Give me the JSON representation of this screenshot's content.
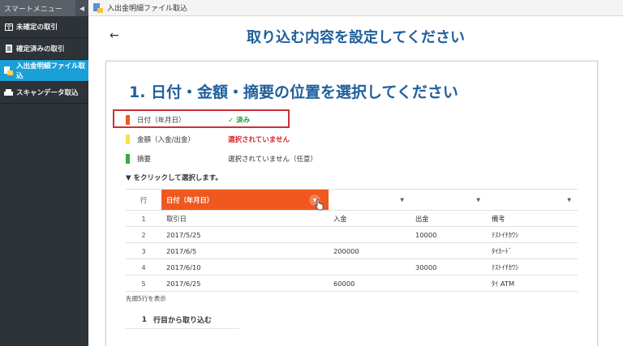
{
  "sidebar": {
    "menu_title": "スマートメニュー",
    "collapse_icon": "chevron-left-icon",
    "items": [
      {
        "label": "未確定の取引",
        "icon": "ledger-icon",
        "active": false
      },
      {
        "label": "確定済みの取引",
        "icon": "document-icon",
        "active": false
      },
      {
        "label": "入出金明細ファイル取込",
        "icon": "file-import-icon",
        "active": true
      },
      {
        "label": "スキャンデータ取込",
        "icon": "scanner-icon",
        "active": false
      }
    ]
  },
  "topbar": {
    "title": "入出金明細ファイル取込"
  },
  "main": {
    "page_title": "取り込む内容を設定してください",
    "step_title": "1. 日付・金額・摘要の位置を選択してください",
    "legend": [
      {
        "label": "日付（年月日）",
        "status": "✓ 済み",
        "swatch_color": "#f0581f",
        "status_color": "#1e9e3a"
      },
      {
        "label": "金額（入金/出金）",
        "status": "選択されていません",
        "swatch_color": "#f5e24a",
        "status_color": "#d8242b"
      },
      {
        "label": "摘要",
        "status": "選択されていません（任意）",
        "swatch_color": "#3aa84a",
        "status_color": "#333333"
      }
    ],
    "instruction": "▼ をクリックして選択します。",
    "table": {
      "row_header": "行",
      "selected_column_label": "日付（年月日）",
      "rows": [
        {
          "num": "1",
          "a": "取引日",
          "b": "入金",
          "c": "出金",
          "d": "備考"
        },
        {
          "num": "2",
          "a": "2017/5/25",
          "b": "",
          "c": "10000",
          "d": "ﾃｽﾄｲﾁｶﾜｼ"
        },
        {
          "num": "3",
          "a": "2017/6/5",
          "b": "200000",
          "c": "",
          "d": "ﾀｲｶｰﾄﾞ"
        },
        {
          "num": "4",
          "a": "2017/6/10",
          "b": "",
          "c": "30000",
          "d": "ﾃｽﾄｲﾁｶﾜｼ"
        },
        {
          "num": "5",
          "a": "2017/6/25",
          "b": "60000",
          "c": "",
          "d": "ﾀｲ ATM"
        }
      ]
    },
    "footnote": "先頭5行を表示",
    "start_row": {
      "num": "1",
      "label": "行目から取り込む"
    }
  }
}
